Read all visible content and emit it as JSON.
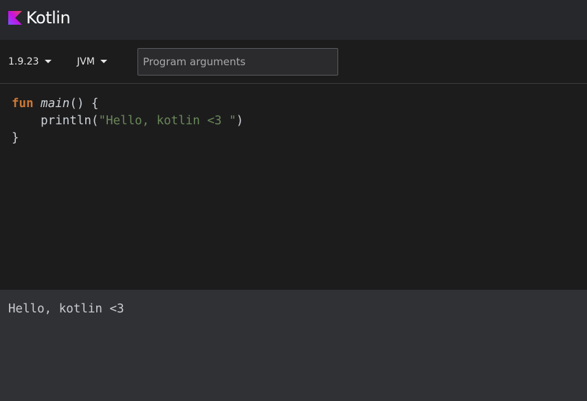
{
  "header": {
    "logo_text": "Kotlin",
    "logo_icon": "kotlin-logo-icon",
    "logo_gradient": [
      "#7f52ff",
      "#c811e2",
      "#e54857"
    ]
  },
  "toolbar": {
    "version_label": "1.9.23",
    "platform_label": "JVM",
    "args_placeholder": "Program arguments",
    "args_value": ""
  },
  "editor": {
    "lines": [
      [
        {
          "type": "kw",
          "text": "fun"
        },
        {
          "type": "plain",
          "text": " "
        },
        {
          "type": "fn",
          "text": "main"
        },
        {
          "type": "plain",
          "text": "() {"
        }
      ],
      [
        {
          "type": "plain",
          "text": "    println("
        },
        {
          "type": "str",
          "text": "\"Hello, kotlin <3 \""
        },
        {
          "type": "plain",
          "text": ")"
        }
      ],
      [
        {
          "type": "plain",
          "text": "}"
        }
      ]
    ]
  },
  "output": {
    "text": "Hello, kotlin <3"
  },
  "colors": {
    "header_bg": "#27282c",
    "editor_bg": "#1c1c1d",
    "output_bg": "#303135",
    "keyword": "#cc7832",
    "string": "#6a8759"
  }
}
